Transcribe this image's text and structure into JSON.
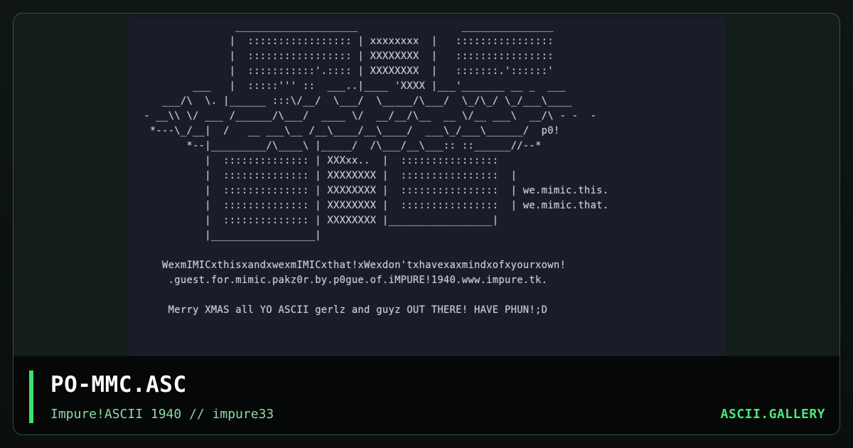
{
  "artwork": {
    "ascii_text": "                 ____________________                 _______________\n                |  ::::::::::::::::: | xxxxxxxx  |   ::::::::::::::::\n                |  ::::::::::::::::: | XXXXXXXX  |   ::::::::::::::::\n                |  :::::::::::'.:::: | XXXXXXXX  |   :::::::.'::::::'\n          ___   |  :::::''' ::  ___..|____ 'XXXX |___'_______ __ _  ___\n     ___/\\  \\. |______ :::\\/__/  \\___/  \\_____/\\___/  \\_/\\_/ \\_/___\\____\n  - __\\\\ \\/ ___ /______/\\___/  ____ \\/  __/__/\\__  __ \\/__ ___\\  __/\\ - -  -\n   *---\\_/__|  /   __ ___\\__ /__\\____/__\\____/  ___\\_/___\\______/  p0!\n         *--|_________/\\____\\ |_____/  /\\___/__\\___:: ::______//--*\n            |  :::::::::::::: | XXXxx..  |  ::::::::::::::::\n            |  :::::::::::::: | XXXXXXXX |  ::::::::::::::::  |\n            |  :::::::::::::: | XXXXXXXX |  ::::::::::::::::  | we.mimic.this.\n            |  :::::::::::::: | XXXXXXXX |  ::::::::::::::::  | we.mimic.that.\n            |  :::::::::::::: | XXXXXXXX |_________________|\n            |_________________|\n\n     WexmIMICxthisxandxwexmIMICxthat!xWexdon'txhavexaxmindxofxyourxown!\n      .guest.for.mimic.pakz0r.by.p0gue.of.iMPURE!1940.www.impure.tk.\n\n      Merry XMAS all YO ASCII gerlz and guyz OUT THERE! HAVE PHUN!;D"
  },
  "footer": {
    "title": "PO-MMC.ASC",
    "subtitle": "Impure!ASCII 1940 // impure33",
    "brand": "ASCII.GALLERY"
  },
  "colors": {
    "accent": "#3ee06e",
    "brand": "#4ee57a",
    "subtitle": "#8fd9a8",
    "card_border": "#2a5a3a",
    "art_background": "#1a1d29"
  }
}
